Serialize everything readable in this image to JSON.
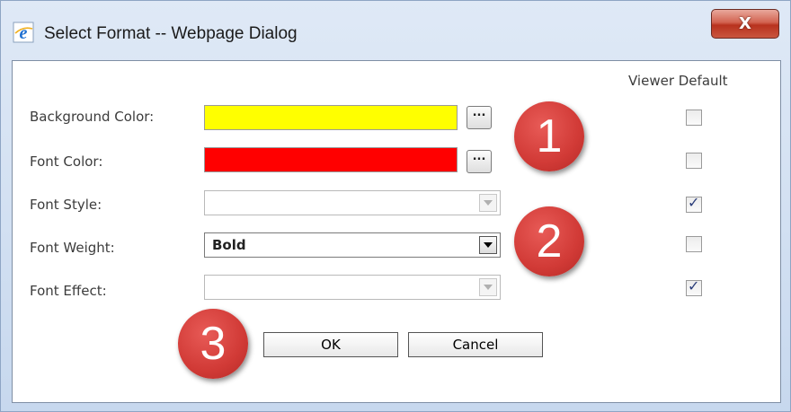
{
  "window": {
    "title": "Select Format -- Webpage Dialog",
    "close_glyph": "X",
    "icon": "ie-icon"
  },
  "header": {
    "viewer_default": "Viewer Default"
  },
  "fields": [
    {
      "label": "Background Color:",
      "type": "color",
      "color": "#ffff00",
      "picker_label": "...",
      "viewer_default": false
    },
    {
      "label": "Font Color:",
      "type": "color",
      "color": "#ff0000",
      "picker_label": "...",
      "viewer_default": false
    },
    {
      "label": "Font Style:",
      "type": "select",
      "value": "",
      "enabled": false,
      "viewer_default": true
    },
    {
      "label": "Font Weight:",
      "type": "select",
      "value": "Bold",
      "enabled": true,
      "viewer_default": false
    },
    {
      "label": "Font Effect:",
      "type": "select",
      "value": "",
      "enabled": false,
      "viewer_default": true
    }
  ],
  "buttons": {
    "ok": "OK",
    "cancel": "Cancel"
  },
  "badges": [
    "1",
    "2",
    "3"
  ],
  "colors": {
    "badge": "#d13a36",
    "close": "#c9563f"
  }
}
